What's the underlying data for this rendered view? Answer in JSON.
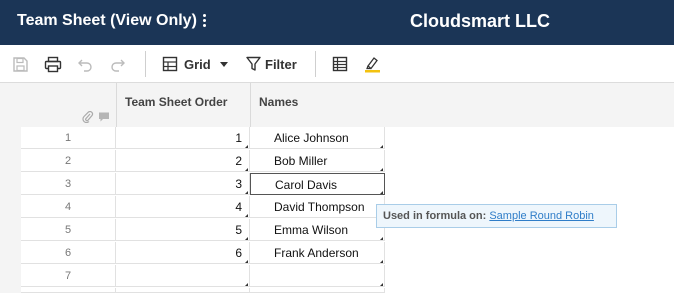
{
  "header": {
    "sheet_title": "Team Sheet (View Only)",
    "company": "Cloudsmart LLC"
  },
  "toolbar": {
    "view_label": "Grid",
    "filter_label": "Filter"
  },
  "columns": {
    "order": "Team Sheet Order",
    "names": "Names"
  },
  "rows": [
    {
      "num": "1",
      "order": "1",
      "name": "Alice Johnson"
    },
    {
      "num": "2",
      "order": "2",
      "name": "Bob Miller"
    },
    {
      "num": "3",
      "order": "3",
      "name": "Carol Davis"
    },
    {
      "num": "4",
      "order": "4",
      "name": "David Thompson"
    },
    {
      "num": "5",
      "order": "5",
      "name": "Emma Wilson"
    },
    {
      "num": "6",
      "order": "6",
      "name": "Frank Anderson"
    },
    {
      "num": "7",
      "order": "",
      "name": ""
    }
  ],
  "tooltip": {
    "prefix": "Used in formula on:",
    "link": "Sample Round Robin"
  },
  "colors": {
    "titlebar": "#1b3556",
    "link": "#2f7dc8"
  }
}
